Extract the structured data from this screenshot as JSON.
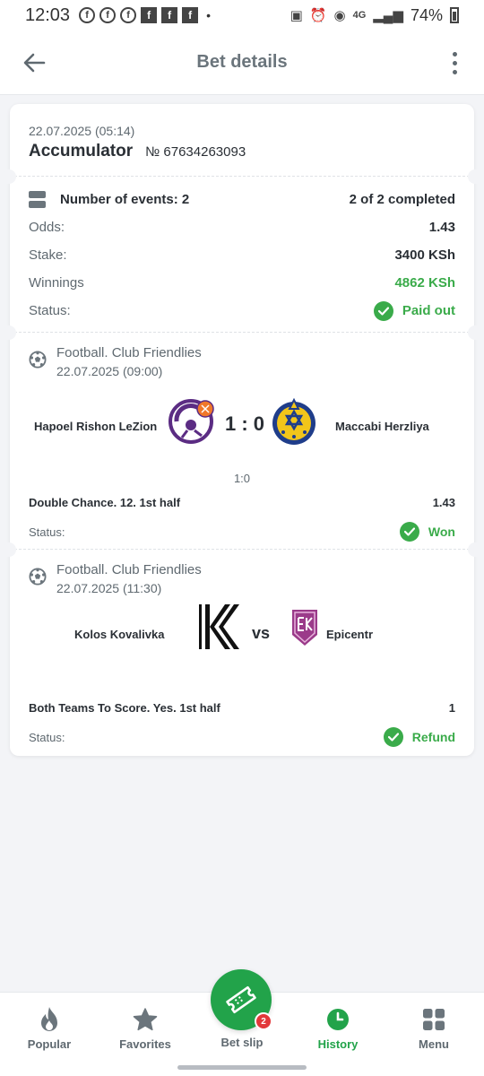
{
  "status_bar": {
    "time": "12:03",
    "network": "4G",
    "battery": "74%"
  },
  "header": {
    "title": "Bet details"
  },
  "bet": {
    "date": "22.07.2025 (05:14)",
    "type": "Accumulator",
    "number": "№ 67634263093",
    "events_label": "Number of events: 2",
    "completed": "2 of 2 completed",
    "odds_label": "Odds:",
    "odds_value": "1.43",
    "stake_label": "Stake:",
    "stake_value": "3400 KSh",
    "winnings_label": "Winnings",
    "winnings_value": "4862 KSh",
    "status_label": "Status:",
    "status_value": "Paid out"
  },
  "events": [
    {
      "league": "Football. Club Friendlies",
      "date": "22.07.2025 (09:00)",
      "home": "Hapoel Rishon LeZion",
      "away": "Maccabi Herzliya",
      "score": "1 : 0",
      "half_score": "1:0",
      "market": "Double Chance. 12. 1st half",
      "odds": "1.43",
      "status_label": "Status:",
      "result": "Won"
    },
    {
      "league": "Football. Club Friendlies",
      "date": "22.07.2025 (11:30)",
      "home": "Kolos Kovalivka",
      "away": "Epicentr",
      "vs": "vs",
      "market": "Both Teams To Score. Yes. 1st half",
      "odds": "1",
      "status_label": "Status:",
      "result": "Refund"
    }
  ],
  "nav": {
    "popular": "Popular",
    "favorites": "Favorites",
    "betslip": "Bet slip",
    "betslip_count": "2",
    "history": "History",
    "menu": "Menu"
  },
  "colors": {
    "accent": "#22a34a",
    "success": "#3aab4a",
    "badge": "#e2383a"
  }
}
